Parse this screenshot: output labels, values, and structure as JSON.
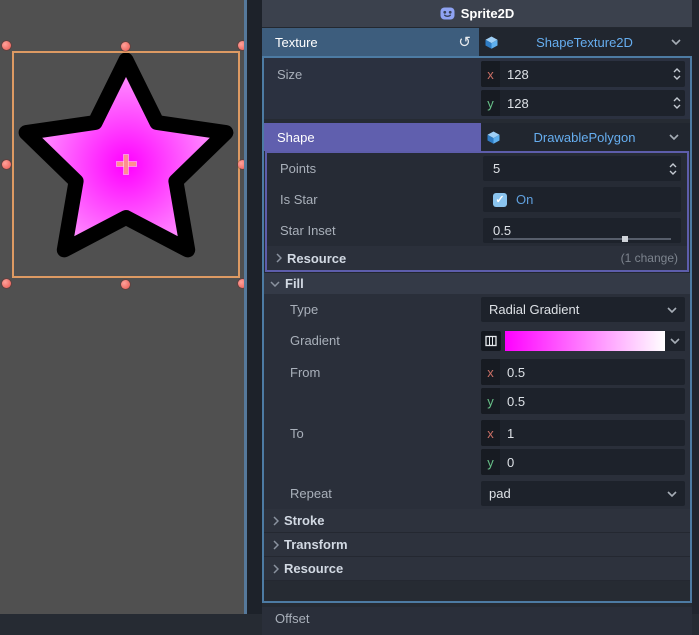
{
  "badges": {
    "x": "x",
    "y": "y"
  },
  "header": {
    "title": "Sprite2D"
  },
  "inspector": {
    "texture": {
      "label": "Texture",
      "value": "ShapeTexture2D"
    },
    "size": {
      "label": "Size",
      "x": "128",
      "y": "128"
    },
    "shape": {
      "label": "Shape",
      "value": "DrawablePolygon"
    },
    "points": {
      "label": "Points",
      "value": "5"
    },
    "is_star": {
      "label": "Is Star",
      "value": "On"
    },
    "star_inset": {
      "label": "Star Inset",
      "value": "0.5",
      "slider_pct": 74
    },
    "resource_inner": {
      "label": "Resource",
      "badge": "(1 change)"
    },
    "fill": {
      "label": "Fill",
      "type": {
        "label": "Type",
        "value": "Radial Gradient"
      },
      "gradient": {
        "label": "Gradient",
        "from_color": "#ff00ff",
        "to_color": "#ffffff"
      },
      "from": {
        "label": "From",
        "x": "0.5",
        "y": "0.5"
      },
      "to": {
        "label": "To",
        "x": "1",
        "y": "0"
      },
      "repeat": {
        "label": "Repeat",
        "value": "pad"
      }
    },
    "sections": [
      {
        "label": "Stroke"
      },
      {
        "label": "Transform"
      },
      {
        "label": "Resource"
      }
    ],
    "offset_label": "Offset"
  },
  "viewport_star": {
    "points": 5,
    "inset": 0.5,
    "fill_center_color": "#ff00ff",
    "fill_edge_color": "#ffffff",
    "outline_color": "#000000",
    "selection_color": "#dd9a63",
    "handle_color": "#ee655e"
  },
  "icons": {
    "sprite2d": "robot-face-icon",
    "revert": "revert-arrow-icon",
    "resource_cube": "cube-icon",
    "chevron_down": "chevron-down-icon",
    "spinner": "updown-spinner-icon",
    "checkbox": "checkbox-checked-icon",
    "gradient_edit": "gradient-edit-icon"
  }
}
